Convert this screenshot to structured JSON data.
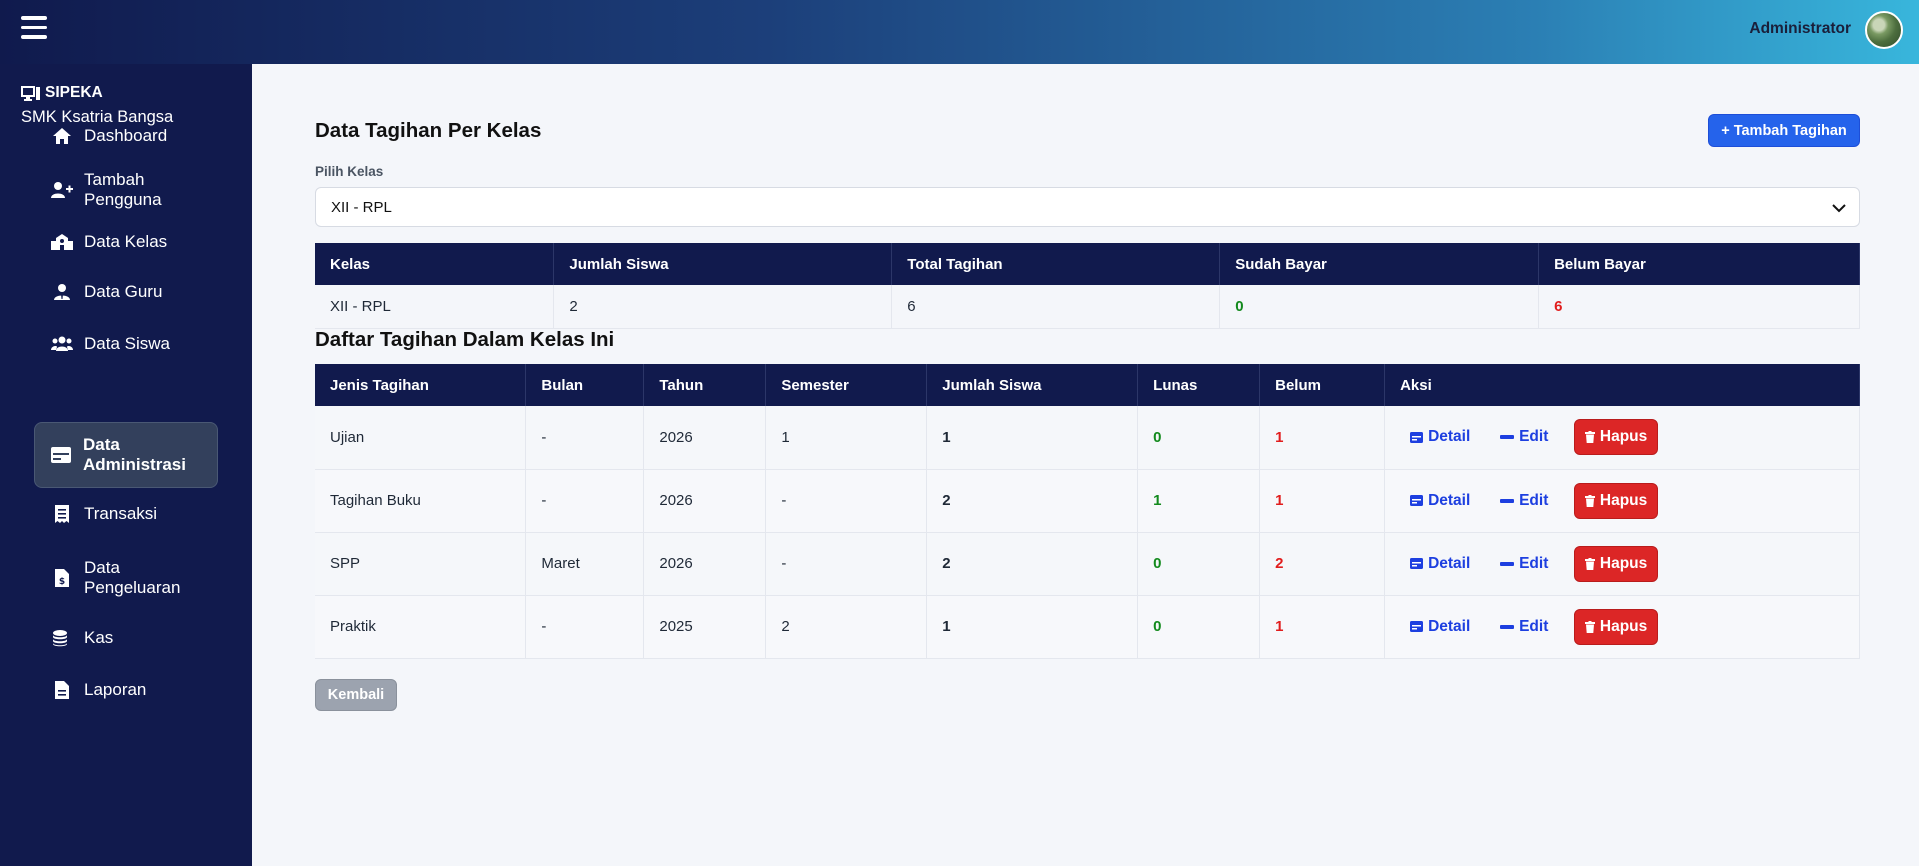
{
  "topbar": {
    "user_name": "Administrator"
  },
  "brand": {
    "title": "SIPEKA",
    "subtitle": "SMK Ksatria Bangsa"
  },
  "sidebar": {
    "items": [
      {
        "label": "Dashboard",
        "icon": "home-icon"
      },
      {
        "label": "Tambah Pengguna",
        "icon": "user-plus-icon"
      },
      {
        "label": "Data Kelas",
        "icon": "school-icon"
      },
      {
        "label": "Data Guru",
        "icon": "user-tie-icon"
      },
      {
        "label": "Data Siswa",
        "icon": "users-icon"
      },
      {
        "label": "Data Administrasi",
        "icon": "id-card-icon",
        "active": true
      },
      {
        "label": "Transaksi",
        "icon": "receipt-icon"
      },
      {
        "label": "Data Pengeluaran",
        "icon": "invoice-dollar-icon"
      },
      {
        "label": "Kas",
        "icon": "coins-icon"
      },
      {
        "label": "Laporan",
        "icon": "file-icon"
      }
    ]
  },
  "main": {
    "title": "Data Tagihan Per Kelas",
    "add_button": "+ Tambah Tagihan",
    "select_label": "Pilih Kelas",
    "select_value": "XII - RPL",
    "summary": {
      "headers": [
        "Kelas",
        "Jumlah Siswa",
        "Total Tagihan",
        "Sudah Bayar",
        "Belum Bayar"
      ],
      "row": {
        "kelas": "XII - RPL",
        "jumlah_siswa": "2",
        "total_tagihan": "6",
        "sudah_bayar": "0",
        "belum_bayar": "6"
      }
    },
    "list_title": "Daftar Tagihan Dalam Kelas Ini",
    "bills": {
      "headers": [
        "Jenis Tagihan",
        "Bulan",
        "Tahun",
        "Semester",
        "Jumlah Siswa",
        "Lunas",
        "Belum",
        "Aksi"
      ],
      "rows": [
        {
          "jenis": "Ujian",
          "bulan": "-",
          "tahun": "2026",
          "semester": "1",
          "jumlah": "1",
          "lunas": "0",
          "belum": "1"
        },
        {
          "jenis": "Tagihan Buku",
          "bulan": "-",
          "tahun": "2026",
          "semester": "-",
          "jumlah": "2",
          "lunas": "1",
          "belum": "1"
        },
        {
          "jenis": "SPP",
          "bulan": "Maret",
          "tahun": "2026",
          "semester": "-",
          "jumlah": "2",
          "lunas": "0",
          "belum": "2"
        },
        {
          "jenis": "Praktik",
          "bulan": "-",
          "tahun": "2025",
          "semester": "2",
          "jumlah": "1",
          "lunas": "0",
          "belum": "1"
        }
      ],
      "actions": {
        "detail": "Detail",
        "edit": "Edit",
        "delete": "Hapus"
      }
    },
    "back_button": "Kembali"
  },
  "colors": {
    "sidebar": "#111a4d",
    "primary": "#2563eb",
    "danger": "#dc2626",
    "success": "#138a1d"
  }
}
